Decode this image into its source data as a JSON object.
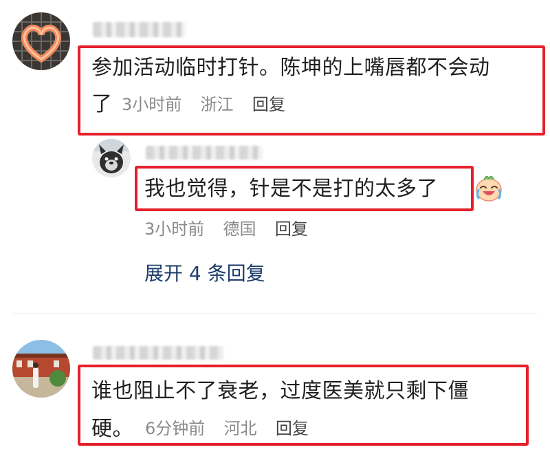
{
  "comments": [
    {
      "id": "c1",
      "text_line1": "参加活动临时打针。陈坤的上嘴唇都不会动",
      "text_line2": "了",
      "time": "3小时前",
      "location": "浙江",
      "reply_label": "回复"
    },
    {
      "id": "c2",
      "text": "我也觉得，针是不是打的太多了",
      "emoji": "crying-laughing-face",
      "time": "3小时前",
      "location": "德国",
      "reply_label": "回复"
    },
    {
      "id": "c3",
      "text_line1": "谁也阻止不了衰老，过度医美就只剩下僵",
      "text_line2": "硬。",
      "time": "6分钟前",
      "location": "河北",
      "reply_label": "回复"
    }
  ],
  "expand_replies_label": "展开 4 条回复",
  "colors": {
    "highlight": "#e5202c",
    "text": "#1f1f1f",
    "meta": "#8a8a8a",
    "link": "#1d3d6b"
  }
}
